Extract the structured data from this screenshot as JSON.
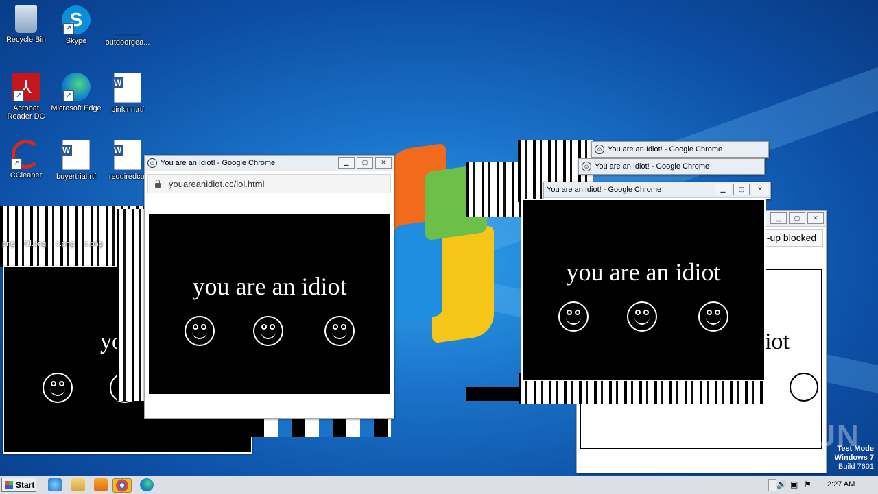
{
  "desktop": {
    "icons": [
      {
        "label": "Recycle Bin"
      },
      {
        "label": "Skype"
      },
      {
        "label": "outdoorgea..."
      },
      {
        "label": "Acrobat Reader DC"
      },
      {
        "label": "Microsoft Edge"
      },
      {
        "label": "pinkinn.rtf"
      },
      {
        "label": "CCleaner"
      },
      {
        "label": "buyertrial.rtf"
      },
      {
        "label": "requiredcul"
      }
    ],
    "png_labels": [
      ".png",
      "Cl.png",
      "c.png",
      "e.png"
    ]
  },
  "windows": {
    "main": {
      "title": "You are an Idiot! - Google Chrome",
      "url": "youareanidiot.cc/lol.html",
      "message": "you are an idiot"
    },
    "right_main": {
      "title": "You are an Idiot! - Google Chrome",
      "message": "you are an idiot"
    },
    "stack_top": {
      "title": "You are an Idiot! - Google Chrome"
    },
    "stack_second": {
      "title": "You are an Idiot! - Google Chrome"
    },
    "popup_blocked": {
      "text": "-up blocked",
      "partial_message": "iot"
    },
    "left_partial": {
      "partial_message": "yo"
    }
  },
  "taskbar": {
    "start_label": "Start",
    "clock": "2:27 AM"
  },
  "watermark": {
    "line1": "Test Mode",
    "line2": "Windows 7",
    "line3": "Build 7601",
    "brand": "ANY RUN"
  },
  "colors": {
    "desktop_blue": "#1a73c9",
    "panel_black": "#000000"
  }
}
